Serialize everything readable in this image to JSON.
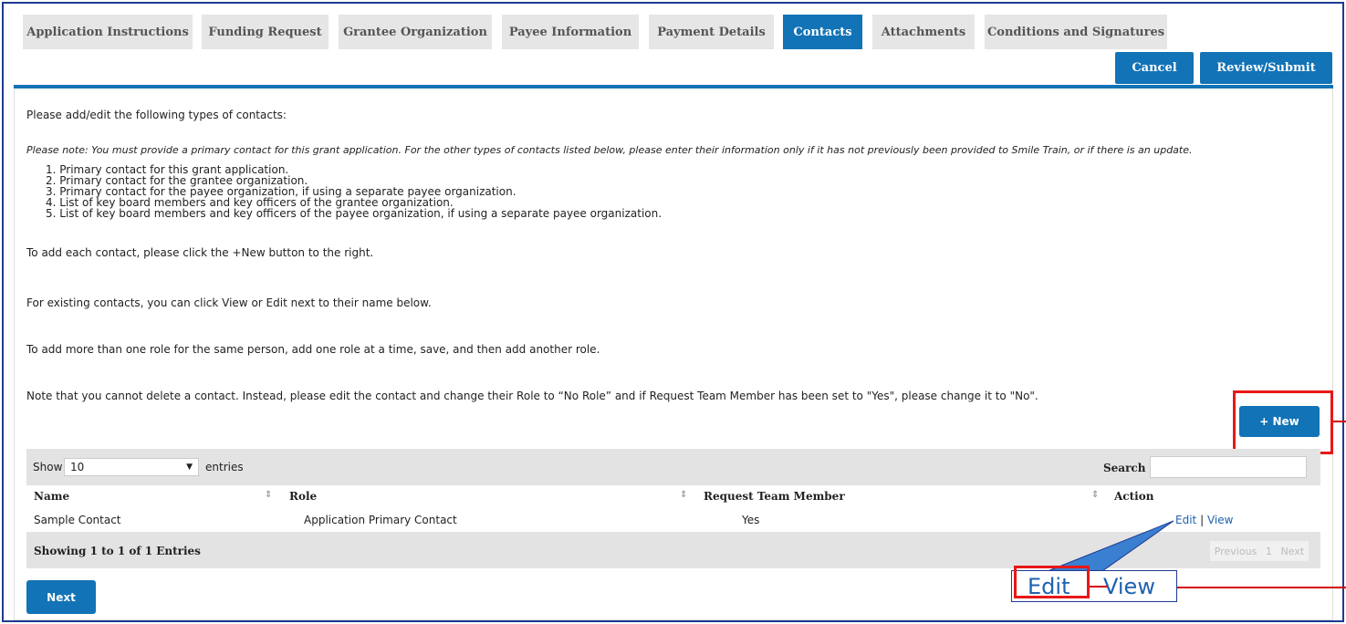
{
  "tabs": [
    {
      "label": "Application Instructions"
    },
    {
      "label": "Funding Request"
    },
    {
      "label": "Grantee Organization"
    },
    {
      "label": "Payee Information"
    },
    {
      "label": "Payment Details"
    },
    {
      "label": "Contacts",
      "active": true
    },
    {
      "label": "Attachments"
    },
    {
      "label": "Conditions and Signatures"
    }
  ],
  "actions": {
    "cancel": "Cancel",
    "review_submit": "Review/Submit"
  },
  "content": {
    "intro": "Please add/edit the following types of contacts:",
    "note": "Please note: You must provide a primary contact for this grant application. For the other types of contacts listed below, please enter their information only if it has not previously been provided to Smile Train, or if there is an update.",
    "steps": [
      "1. Primary contact for this grant application.",
      "2. Primary contact for the grantee organization.",
      "3. Primary contact for the payee organization, if using a separate payee organization.",
      "4. List of key board members and key officers of the grantee organization.",
      "5. List of key board members and key officers of the payee organization, if using a separate payee organization."
    ],
    "add_hint": "To add each contact, please click the +New button to the right.",
    "existing_hint": "For existing contacts, you can click View or Edit next to their name below.",
    "role_hint": "To add more than one role for the same person, add one role at a time, save, and then add another role.",
    "delete_hint": "Note that you cannot delete a contact. Instead, please edit the contact and change their Role to “No Role” and if Request Team Member has been set to \"Yes\", please change it to \"No\"."
  },
  "new_button": "+ New",
  "table": {
    "show_label": "Show",
    "show_value": "10",
    "entries_label": "entries",
    "search_label": "Search",
    "columns": [
      "Name",
      "Role",
      "Request Team Member",
      "Action"
    ],
    "rows": [
      {
        "name": "Sample Contact",
        "role": "Application Primary Contact",
        "team_member": "Yes",
        "edit": "Edit",
        "sep": "|",
        "view": "View"
      }
    ],
    "footer": "Showing 1 to 1 of 1 Entries",
    "pager": {
      "previous": "Previous",
      "page": "1",
      "next": "Next"
    }
  },
  "callout": {
    "edit": "Edit",
    "view": "View"
  },
  "next_button": "Next",
  "colors": {
    "accent": "#1273b6",
    "highlight": "#e81818",
    "tab_bg": "#e6e6e6",
    "frame": "#1f3a93"
  }
}
